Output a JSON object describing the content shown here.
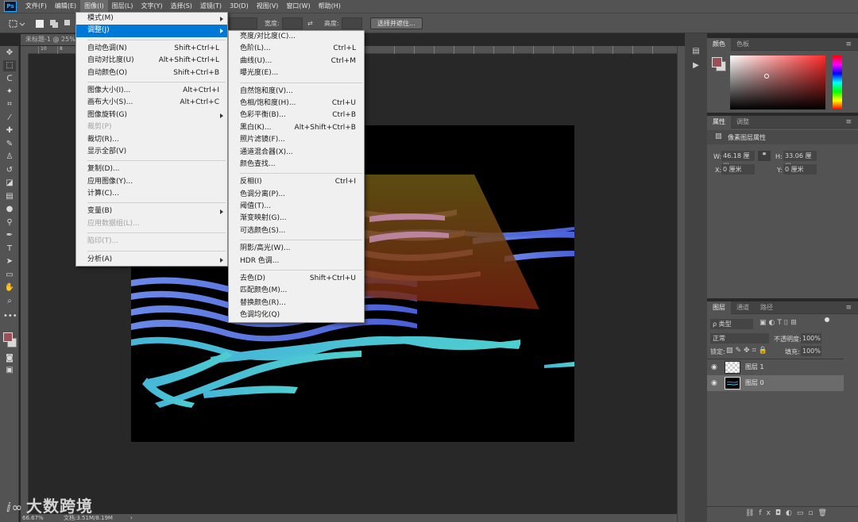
{
  "menubar": {
    "logo": "Ps",
    "items": [
      "文件(F)",
      "编辑(E)",
      "图像(I)",
      "图层(L)",
      "文字(Y)",
      "选择(S)",
      "滤镜(T)",
      "3D(D)",
      "视图(V)",
      "窗口(W)",
      "帮助(H)"
    ],
    "active_index": 2
  },
  "options": {
    "width_label": "宽度:",
    "height_label": "高度:",
    "select_mask_button": "选择并遮住..."
  },
  "document": {
    "tab_title": "未标题-1 @ 25%"
  },
  "ruler": {
    "h_ticks": [
      "10",
      "8"
    ]
  },
  "image_menu": {
    "groups": [
      [
        {
          "label": "模式(M)",
          "submenu": true
        },
        {
          "label": "调整(J)",
          "submenu": true,
          "highlighted": true
        }
      ],
      [
        {
          "label": "自动色调(N)",
          "shortcut": "Shift+Ctrl+L"
        },
        {
          "label": "自动对比度(U)",
          "shortcut": "Alt+Shift+Ctrl+L"
        },
        {
          "label": "自动颜色(O)",
          "shortcut": "Shift+Ctrl+B"
        }
      ],
      [
        {
          "label": "图像大小(I)...",
          "shortcut": "Alt+Ctrl+I"
        },
        {
          "label": "画布大小(S)...",
          "shortcut": "Alt+Ctrl+C"
        },
        {
          "label": "图像旋转(G)",
          "submenu": true
        },
        {
          "label": "裁剪(P)",
          "disabled": true
        },
        {
          "label": "裁切(R)..."
        },
        {
          "label": "显示全部(V)"
        }
      ],
      [
        {
          "label": "复制(D)..."
        },
        {
          "label": "应用图像(Y)..."
        },
        {
          "label": "计算(C)..."
        }
      ],
      [
        {
          "label": "变量(B)",
          "submenu": true
        },
        {
          "label": "应用数据组(L)...",
          "disabled": true
        }
      ],
      [
        {
          "label": "陷印(T)...",
          "disabled": true
        }
      ],
      [
        {
          "label": "分析(A)",
          "submenu": true
        }
      ]
    ]
  },
  "adjust_menu": {
    "groups": [
      [
        {
          "label": "亮度/对比度(C)..."
        },
        {
          "label": "色阶(L)...",
          "shortcut": "Ctrl+L"
        },
        {
          "label": "曲线(U)...",
          "shortcut": "Ctrl+M"
        },
        {
          "label": "曝光度(E)..."
        }
      ],
      [
        {
          "label": "自然饱和度(V)..."
        },
        {
          "label": "色相/饱和度(H)...",
          "shortcut": "Ctrl+U"
        },
        {
          "label": "色彩平衡(B)...",
          "shortcut": "Ctrl+B"
        },
        {
          "label": "黑白(K)...",
          "shortcut": "Alt+Shift+Ctrl+B"
        },
        {
          "label": "照片滤镜(F)..."
        },
        {
          "label": "通道混合器(X)..."
        },
        {
          "label": "颜色查找..."
        }
      ],
      [
        {
          "label": "反相(I)",
          "shortcut": "Ctrl+I"
        },
        {
          "label": "色调分离(P)..."
        },
        {
          "label": "阈值(T)..."
        },
        {
          "label": "渐变映射(G)..."
        },
        {
          "label": "可选颜色(S)..."
        }
      ],
      [
        {
          "label": "阴影/高光(W)..."
        },
        {
          "label": "HDR 色调..."
        }
      ],
      [
        {
          "label": "去色(D)",
          "shortcut": "Shift+Ctrl+U"
        },
        {
          "label": "匹配颜色(M)..."
        },
        {
          "label": "替换颜色(R)..."
        },
        {
          "label": "色调均化(Q)"
        }
      ]
    ]
  },
  "color_panel": {
    "tabs": [
      "颜色",
      "色板"
    ],
    "hue_color": "#ff2a2a"
  },
  "properties_panel": {
    "tabs": [
      "属性",
      "调整"
    ],
    "title": "像素图层属性",
    "w_label": "W:",
    "w_value": "46.18 厘米",
    "h_label": "H:",
    "h_value": "33.06 厘米",
    "x_label": "X:",
    "x_value": "0 厘米",
    "y_label": "Y:",
    "y_value": "0 厘米"
  },
  "layers_panel": {
    "tabs": [
      "图层",
      "通道",
      "路径"
    ],
    "kind_filter": "ρ 类型",
    "blend_mode": "正常",
    "opacity_label": "不透明度:",
    "opacity_value": "100%",
    "lock_label": "锁定:",
    "fill_label": "填充:",
    "fill_value": "100%",
    "layers": [
      {
        "name": "图层 1",
        "selected": false
      },
      {
        "name": "图层 0",
        "selected": true
      }
    ]
  },
  "status": {
    "zoom": "66.67%",
    "doc_info": "文档:3.51M/8.19M"
  },
  "watermark": "大数跨境",
  "colors": {
    "menu_highlight": "#0078d7",
    "foreground": "#9c4f55",
    "background": "#d8d8d8"
  }
}
